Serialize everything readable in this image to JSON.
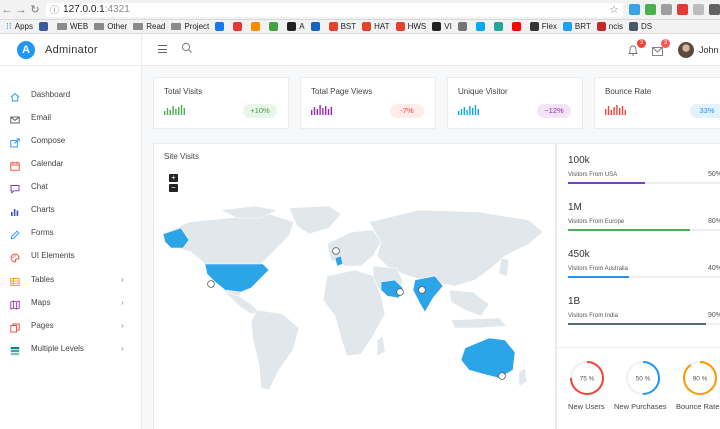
{
  "browser": {
    "url_host": "127.0.0.1",
    "url_port": ":4321",
    "bookmarks": [
      {
        "label": "Apps",
        "type": "apps"
      },
      {
        "label": "",
        "type": "fav",
        "color": "#3b5998"
      },
      {
        "label": "WEB",
        "type": "folder"
      },
      {
        "label": "Other",
        "type": "folder"
      },
      {
        "label": "Read",
        "type": "folder"
      },
      {
        "label": "Project",
        "type": "folder"
      },
      {
        "label": "",
        "type": "fav",
        "color": "#1877f2"
      },
      {
        "label": "",
        "type": "fav",
        "color": "#e53935"
      },
      {
        "label": "",
        "type": "fav",
        "color": "#fb8c00"
      },
      {
        "label": "",
        "type": "fav",
        "color": "#43a047"
      },
      {
        "label": "A",
        "type": "fav",
        "color": "#222222"
      },
      {
        "label": "",
        "type": "fav",
        "color": "#1565c0"
      },
      {
        "label": "BST",
        "type": "fav",
        "color": "#e2432a"
      },
      {
        "label": "HAT",
        "type": "fav",
        "color": "#e2432a"
      },
      {
        "label": "HWS",
        "type": "fav",
        "color": "#e2432a"
      },
      {
        "label": "VI",
        "type": "fav",
        "color": "#222222"
      },
      {
        "label": "",
        "type": "fav",
        "color": "#757575"
      },
      {
        "label": "",
        "type": "fav",
        "color": "#03a9f4"
      },
      {
        "label": "",
        "type": "fav",
        "color": "#26a69a"
      },
      {
        "label": "",
        "type": "fav",
        "color": "#ff0000"
      },
      {
        "label": "Flex",
        "type": "fav",
        "color": "#333333"
      },
      {
        "label": "BRT",
        "type": "fav",
        "color": "#1da1f2"
      },
      {
        "label": "ncis",
        "type": "fav",
        "color": "#c62828"
      },
      {
        "label": "DS",
        "type": "fav",
        "color": "#455a64"
      }
    ],
    "extensions": [
      "#3aa3e3",
      "#4caf50",
      "#9e9e9e",
      "#e53935",
      "#bdbdbd",
      "#616161"
    ]
  },
  "header": {
    "brand": "Adminator",
    "logo_letter": "A",
    "notifications_count": "3",
    "messages_count": "3",
    "user_name": "John Doe"
  },
  "sidebar": {
    "items": [
      {
        "label": "Dashboard",
        "icon": "home-icon",
        "color": "#2196f3",
        "chevron": false
      },
      {
        "label": "Email",
        "icon": "mail-icon",
        "color": "#555555",
        "chevron": false
      },
      {
        "label": "Compose",
        "icon": "share-icon",
        "color": "#2196f3",
        "chevron": false
      },
      {
        "label": "Calendar",
        "icon": "calendar-icon",
        "color": "#f44336",
        "chevron": false
      },
      {
        "label": "Chat",
        "icon": "chat-icon",
        "color": "#673ab7",
        "chevron": false
      },
      {
        "label": "Charts",
        "icon": "bar-chart-icon",
        "color": "#3f51b5",
        "chevron": false
      },
      {
        "label": "Forms",
        "icon": "pencil-icon",
        "color": "#2196f3",
        "chevron": false
      },
      {
        "label": "UI Elements",
        "icon": "palette-icon",
        "color": "#f44336",
        "chevron": false
      },
      {
        "label": "Tables",
        "icon": "table-icon",
        "color": "#ff9800",
        "chevron": true
      },
      {
        "label": "Maps",
        "icon": "map-icon",
        "color": "#9c27b0",
        "chevron": true
      },
      {
        "label": "Pages",
        "icon": "pages-icon",
        "color": "#f44336",
        "chevron": true
      },
      {
        "label": "Multiple Levels",
        "icon": "layers-icon",
        "color": "#00897b",
        "chevron": true
      }
    ]
  },
  "stats": [
    {
      "title": "Total Visits",
      "value": "+10%",
      "spark_color": "#4caf50",
      "pill_bg": "#e8f5e9",
      "pill_fg": "#43a047"
    },
    {
      "title": "Total Page Views",
      "value": "-7%",
      "spark_color": "#9c27b0",
      "pill_bg": "#fdecea",
      "pill_fg": "#e53935"
    },
    {
      "title": "Unique Visitor",
      "value": "~12%",
      "spark_color": "#03a9f4",
      "pill_bg": "#f3e5f5",
      "pill_fg": "#8e24aa"
    },
    {
      "title": "Bounce Rate",
      "value": "33%",
      "spark_color": "#f44336",
      "pill_bg": "#e3f2fd",
      "pill_fg": "#2196f3"
    }
  ],
  "site_visits": {
    "title": "Site Visits",
    "zoom_in": "+",
    "zoom_out": "−",
    "map_base_color": "#e2e7eb",
    "highlight_color": "#2ba4e8"
  },
  "countries": [
    {
      "value": "100k",
      "label": "Visitors From USA",
      "percent": "50%",
      "fill": 0.5,
      "color": "#6f42c1"
    },
    {
      "value": "1M",
      "label": "Visitors From Europe",
      "percent": "80%",
      "fill": 0.8,
      "color": "#4caf50"
    },
    {
      "value": "450k",
      "label": "Visitors From Australia",
      "percent": "40%",
      "fill": 0.4,
      "color": "#2196f3"
    },
    {
      "value": "1B",
      "label": "Visitors From India",
      "percent": "90%",
      "fill": 0.9,
      "color": "#546e7a"
    }
  ],
  "donuts": [
    {
      "value": "75 %",
      "label": "New Users",
      "fraction": 0.75,
      "color": "#f44336"
    },
    {
      "value": "50 %",
      "label": "New Purchases",
      "fraction": 0.5,
      "color": "#2196f3"
    },
    {
      "value": "90 %",
      "label": "Bounce Rate",
      "fraction": 0.9,
      "color": "#ff9800"
    }
  ]
}
